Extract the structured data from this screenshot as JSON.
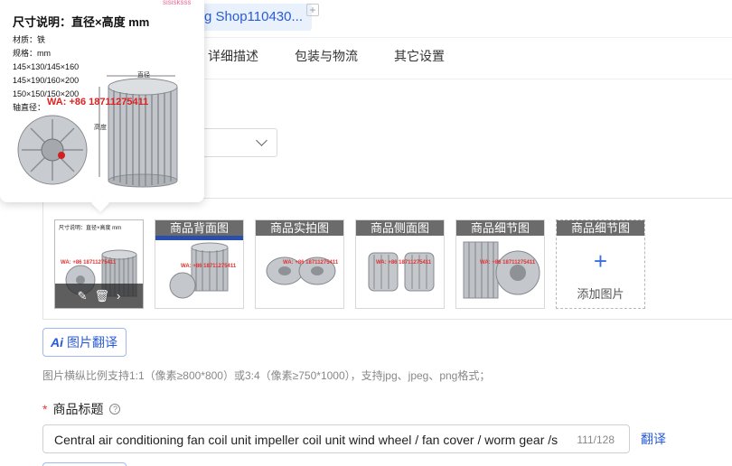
{
  "header": {
    "shop_tag": "g Shop110430...",
    "add_symbol": "+",
    "top_fragment": "sisisksss"
  },
  "tabs": [
    {
      "label": "详细描述"
    },
    {
      "label": "包装与物流"
    },
    {
      "label": "其它设置"
    }
  ],
  "popup": {
    "title": "尺寸说明：直径×高度 mm",
    "lines": [
      "材质：铁",
      "规格：mm",
      "145×130/145×160",
      "145×190/160×200",
      "150×150/150×200",
      "轴直径："
    ],
    "watermark": "WA: +86 18711275411",
    "label_diameter": "直径",
    "label_height": "高度"
  },
  "images": {
    "thumbs": [
      {
        "label": "",
        "watermark": "WA: +86 18711275411"
      },
      {
        "label": "商品背面图",
        "watermark": "WA: +86 18711275411"
      },
      {
        "label": "商品实拍图",
        "watermark": "WA: +86 18711275411"
      },
      {
        "label": "商品侧面图",
        "watermark": "WA: +86 18711275411"
      },
      {
        "label": "商品细节图",
        "watermark": "WA: +86 18711275411"
      }
    ],
    "add_slot": {
      "label": "商品细节图",
      "plus": "+",
      "text": "添加图片"
    },
    "overlay_icons": [
      "edit-icon",
      "trash-icon",
      "chevron-right-icon"
    ]
  },
  "translate_button": {
    "ai": "Ai",
    "label": "图片翻译"
  },
  "hint": "图片横纵比例支持1:1（像素≥800*800）或3:4（像素≥750*1000），支持jpg、jpeg、png格式；",
  "title_field": {
    "required": "*",
    "label": "商品标题",
    "value": "Central air conditioning fan coil unit impeller coil unit wind wheel / fan cover / worm gear /s",
    "count": "111/128",
    "translate": "翻译"
  },
  "colors": {
    "accent": "#2a5bd7",
    "required": "#e53935",
    "watermark": "#e02020"
  }
}
